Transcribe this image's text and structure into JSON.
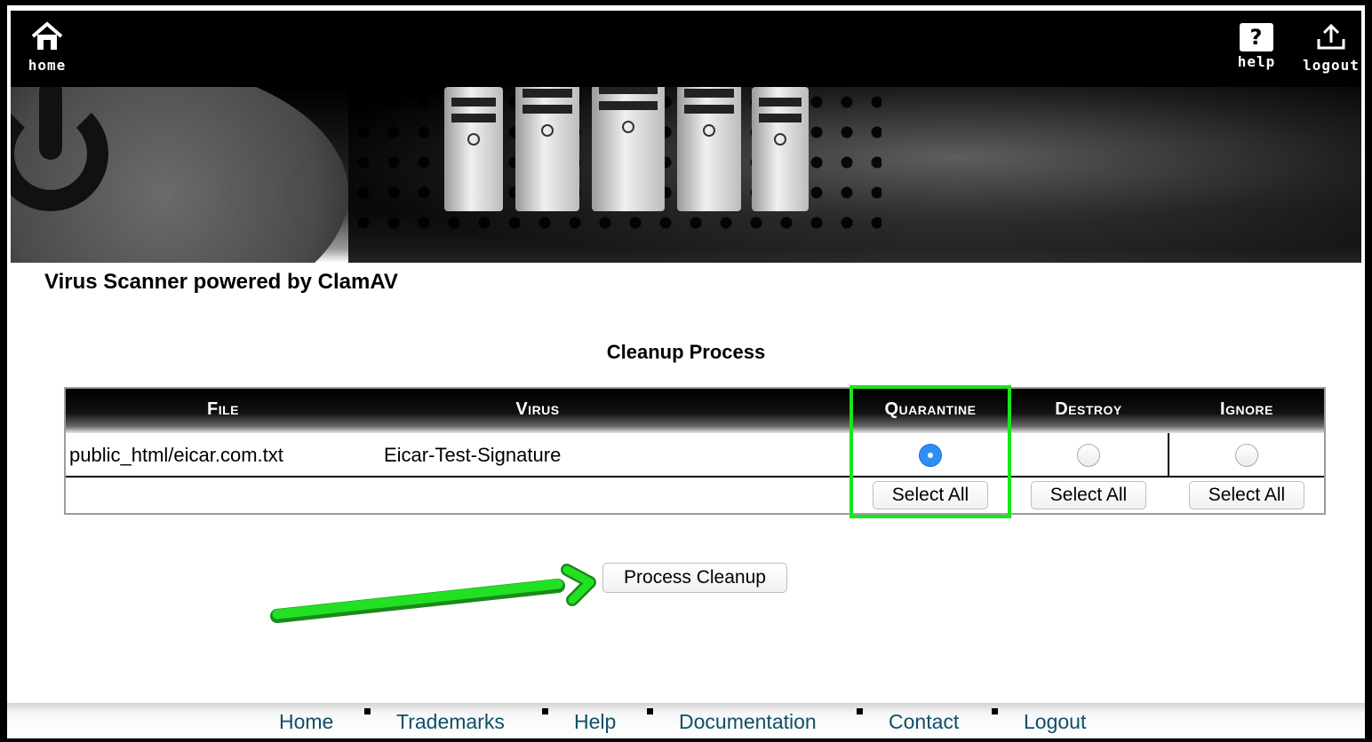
{
  "nav": {
    "home_label": "home",
    "help_label": "help",
    "logout_label": "logout",
    "help_glyph": "?"
  },
  "app_title": "Virus Scanner powered by ClamAV",
  "section_title": "Cleanup Process",
  "table": {
    "headers": {
      "file": "File",
      "virus": "Virus",
      "quarantine": "Quarantine",
      "destroy": "Destroy",
      "ignore": "Ignore"
    },
    "rows": [
      {
        "file": "public_html/eicar.com.txt",
        "virus": "Eicar-Test-Signature",
        "selected_action": "quarantine"
      }
    ],
    "select_all_label": "Select All"
  },
  "process_button": "Process Cleanup",
  "footer_links": [
    "Home",
    "Trademarks",
    "Help",
    "Documentation",
    "Contact",
    "Logout"
  ],
  "colors": {
    "highlight": "#19e619",
    "link": "#0e4f68",
    "radio_selected": "#2f8ef6"
  },
  "icons": [
    "home-icon",
    "help-icon",
    "logout-icon",
    "power-icon",
    "arrow-annotation-icon"
  ]
}
